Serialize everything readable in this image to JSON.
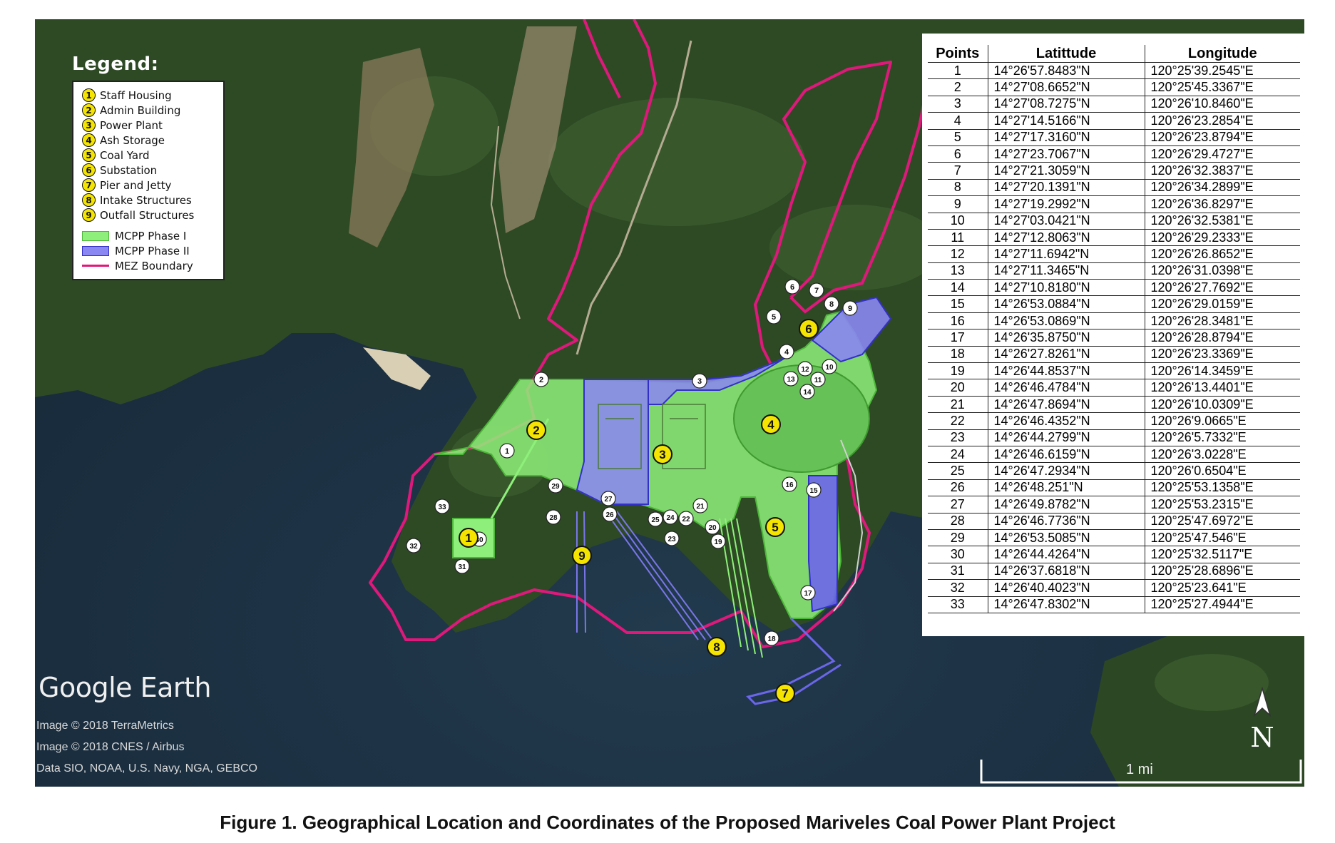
{
  "legend": {
    "title": "Legend:",
    "items": [
      {
        "num": "1",
        "label": "Staff Housing"
      },
      {
        "num": "2",
        "label": "Admin Building"
      },
      {
        "num": "3",
        "label": "Power Plant"
      },
      {
        "num": "4",
        "label": "Ash Storage"
      },
      {
        "num": "5",
        "label": "Coal Yard"
      },
      {
        "num": "6",
        "label": "Substation"
      },
      {
        "num": "7",
        "label": "Pier and Jetty"
      },
      {
        "num": "8",
        "label": "Intake Structures"
      },
      {
        "num": "9",
        "label": "Outfall Structures"
      }
    ],
    "areas": [
      {
        "label": "MCPP Phase I",
        "color": "#8ef07a"
      },
      {
        "label": "MCPP Phase II",
        "color": "#8a86f2"
      },
      {
        "label": "MEZ Boundary",
        "color": "#e0187c"
      }
    ]
  },
  "table": {
    "headers": [
      "Points",
      "Latittude",
      "Longitude"
    ],
    "rows": [
      [
        "1",
        "14°26'57.8483\"N",
        "120°25'39.2545\"E"
      ],
      [
        "2",
        "14°27'08.6652\"N",
        "120°25'45.3367\"E"
      ],
      [
        "3",
        "14°27'08.7275\"N",
        "120°26'10.8460\"E"
      ],
      [
        "4",
        "14°27'14.5166\"N",
        "120°26'23.2854\"E"
      ],
      [
        "5",
        "14°27'17.3160\"N",
        "120°26'23.8794\"E"
      ],
      [
        "6",
        "14°27'23.7067\"N",
        "120°26'29.4727\"E"
      ],
      [
        "7",
        "14°27'21.3059\"N",
        "120°26'32.3837\"E"
      ],
      [
        "8",
        "14°27'20.1391\"N",
        "120°26'34.2899\"E"
      ],
      [
        "9",
        "14°27'19.2992\"N",
        "120°26'36.8297\"E"
      ],
      [
        "10",
        "14°27'03.0421\"N",
        "120°26'32.5381\"E"
      ],
      [
        "11",
        "14°27'12.8063\"N",
        "120°26'29.2333\"E"
      ],
      [
        "12",
        "14°27'11.6942\"N",
        "120°26'26.8652\"E"
      ],
      [
        "13",
        "14°27'11.3465\"N",
        "120°26'31.0398\"E"
      ],
      [
        "14",
        "14°27'10.8180\"N",
        "120°26'27.7692\"E"
      ],
      [
        "15",
        "14°26'53.0884\"N",
        "120°26'29.0159\"E"
      ],
      [
        "16",
        "14°26'53.0869\"N",
        "120°26'28.3481\"E"
      ],
      [
        "17",
        "14°26'35.8750\"N",
        "120°26'28.8794\"E"
      ],
      [
        "18",
        "14°26'27.8261\"N",
        "120°26'23.3369\"E"
      ],
      [
        "19",
        "14°26'44.8537\"N",
        "120°26'14.3459\"E"
      ],
      [
        "20",
        "14°26'46.4784\"N",
        "120°26'13.4401\"E"
      ],
      [
        "21",
        "14°26'47.8694\"N",
        "120°26'10.0309\"E"
      ],
      [
        "22",
        "14°26'46.4352\"N",
        "120°26'9.0665\"E"
      ],
      [
        "23",
        "14°26'44.2799\"N",
        "120°26'5.7332\"E"
      ],
      [
        "24",
        "14°26'46.6159\"N",
        "120°26'3.0228\"E"
      ],
      [
        "25",
        "14°26'47.2934\"N",
        "120°26'0.6504\"E"
      ],
      [
        "26",
        "14°26'48.251\"N",
        "120°25'53.1358\"E"
      ],
      [
        "27",
        "14°26'49.8782\"N",
        "120°25'53.2315\"E"
      ],
      [
        "28",
        "14°26'46.7736\"N",
        "120°25'47.6972\"E"
      ],
      [
        "29",
        "14°26'53.5085\"N",
        "120°25'47.546\"E"
      ],
      [
        "30",
        "14°26'44.4264\"N",
        "120°25'32.5117\"E"
      ],
      [
        "31",
        "14°26'37.6818\"N",
        "120°25'28.6896\"E"
      ],
      [
        "32",
        "14°26'40.4023\"N",
        "120°25'23.641\"E"
      ],
      [
        "33",
        "14°26'47.8302\"N",
        "120°25'27.4944\"E"
      ]
    ]
  },
  "map": {
    "facility_markers": [
      "1",
      "2",
      "3",
      "4",
      "5",
      "6",
      "7",
      "8",
      "9"
    ],
    "point_markers": [
      "1",
      "2",
      "3",
      "4",
      "5",
      "6",
      "7",
      "8",
      "9",
      "10",
      "11",
      "12",
      "13",
      "14",
      "15",
      "16",
      "17",
      "18",
      "19",
      "20",
      "21",
      "22",
      "23",
      "24",
      "25",
      "26",
      "27",
      "28",
      "29",
      "30",
      "31",
      "32",
      "33"
    ],
    "colors": {
      "water": "#1e3244",
      "land": "#2f4a26",
      "phase1": "#8ef07a",
      "phase2": "#8a86f2",
      "boundary": "#e0187c"
    }
  },
  "attribution": {
    "logo": "Google Earth",
    "credits": [
      "Image © 2018 TerraMetrics",
      "Image © 2018 CNES / Airbus",
      "Data SIO, NOAA, U.S. Navy, NGA, GEBCO"
    ]
  },
  "north_label": "N",
  "scale_label": "1 mi",
  "caption": "Figure 1. Geographical Location and Coordinates of the Proposed Mariveles Coal Power Plant Project"
}
